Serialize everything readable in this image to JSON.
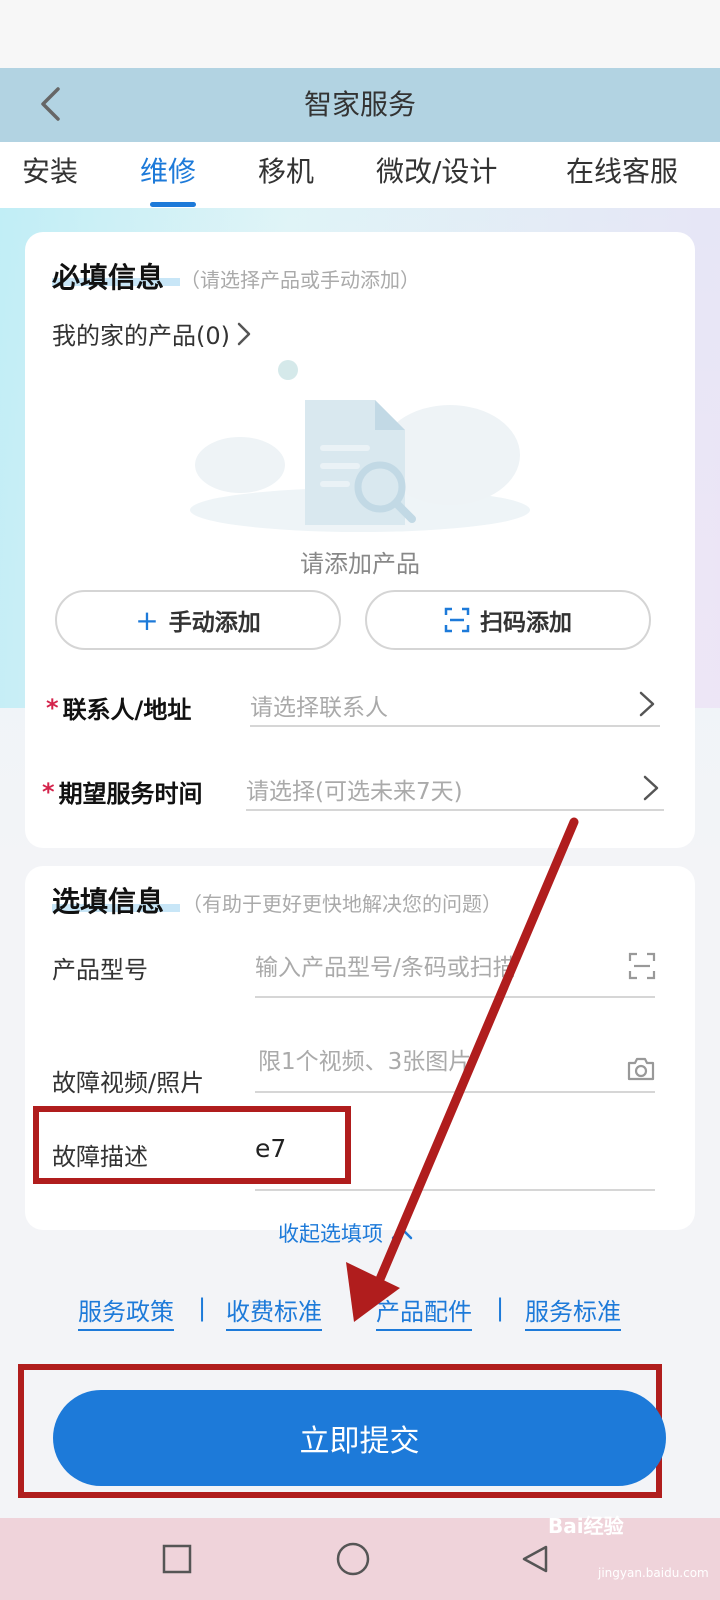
{
  "header": {
    "title": "智家服务"
  },
  "tabs": [
    {
      "label": "安装"
    },
    {
      "label": "维修"
    },
    {
      "label": "移机"
    },
    {
      "label": "微改/设计"
    },
    {
      "label": "在线客服"
    }
  ],
  "required_section": {
    "title": "必填信息",
    "hint": "（请选择产品或手动添加）",
    "my_products": "我的家的产品(0)",
    "empty_text": "请添加产品",
    "manual_add": "手动添加",
    "scan_add": "扫码添加",
    "contact_label": "联系人/地址",
    "contact_placeholder": "请选择联系人",
    "time_label": "期望服务时间",
    "time_placeholder": "请选择(可选未来7天)",
    "required_mark": "*"
  },
  "optional_section": {
    "title": "选填信息",
    "hint": "（有助于更好更快地解决您的问题）",
    "model_label": "产品型号",
    "model_placeholder": "输入产品型号/条码或扫描",
    "media_label": "故障视频/照片",
    "media_placeholder": "限1个视频、3张图片",
    "desc_label": "故障描述",
    "desc_value": "e7"
  },
  "collapse_label": "收起选填项",
  "footer_links": [
    "服务政策",
    "收费标准",
    "产品配件",
    "服务标准"
  ],
  "footer_separator": "|",
  "submit_label": "立即提交",
  "watermark": {
    "brand": "Bai经验",
    "domain": "jingyan.baidu.com"
  },
  "colors": {
    "accent": "#1d7ad9",
    "header_bg": "#b2d3e2",
    "annotation_red": "#b01d1d",
    "required_red": "#d4234b"
  }
}
